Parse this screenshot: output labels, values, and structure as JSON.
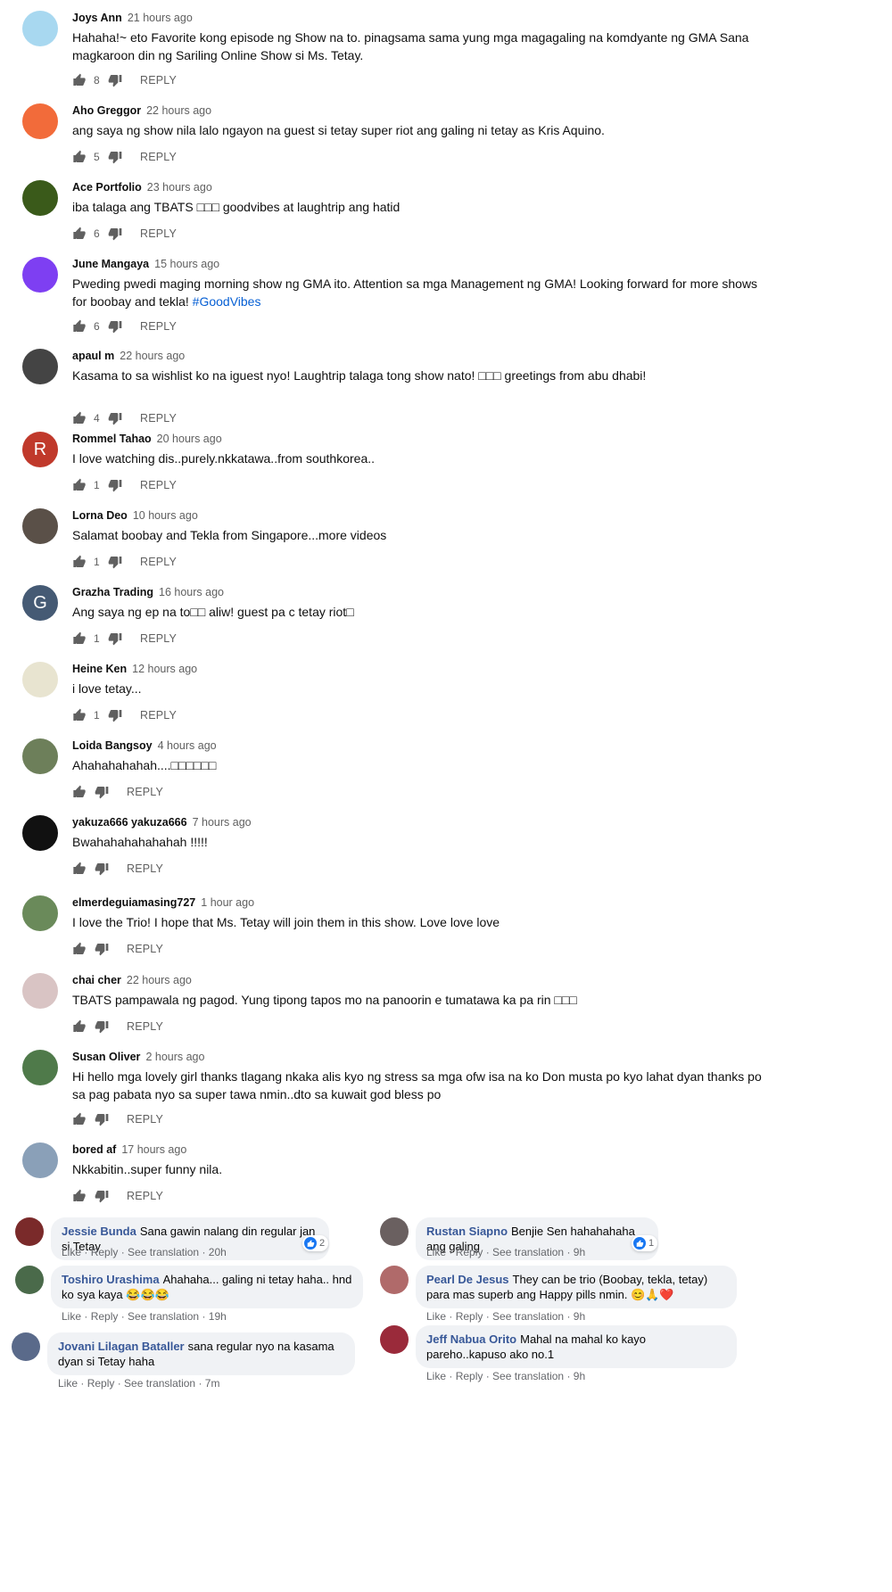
{
  "youtube_comments": [
    {
      "author": "Joys Ann",
      "time": "21 hours ago",
      "text": "Hahaha!~ eto Favorite kong episode ng Show na to. pinagsama sama yung mga magagaling na komdyante ng GMA Sana magkaroon din ng Sariling Online Show si Ms. Tetay.",
      "likes": "8",
      "avatar_color": "#a8d8f0"
    },
    {
      "author": "Aho Greggor",
      "time": "22 hours ago",
      "text": "ang saya ng show nila lalo ngayon na guest si tetay super riot ang galing ni tetay as Kris Aquino.",
      "likes": "5",
      "avatar_color": "#f26b3a"
    },
    {
      "author": "Ace Portfolio",
      "time": "23 hours ago",
      "text": "iba talaga ang TBATS □□□ goodvibes at laughtrip ang hatid",
      "likes": "6",
      "avatar_color": "#3a5a1a"
    },
    {
      "author": "June Mangaya",
      "time": "15 hours ago",
      "text": "Pweding pwedi maging morning show ng GMA ito. Attention sa mga Management ng GMA!  Looking forward for more shows for boobay and tekla! ",
      "hashtag": "#GoodVibes",
      "likes": "6",
      "avatar_color": "#7e3ff2"
    },
    {
      "author": "apaul m",
      "time": "22 hours ago",
      "text": "Kasama to sa wishlist ko na iguest nyo! Laughtrip talaga tong show nato! □□□ greetings from abu dhabi!",
      "likes": "4",
      "avatar_color": "#444444"
    },
    {
      "author": "Rommel Tahao",
      "time": "20 hours ago",
      "text": "I love watching dis..purely.nkkatawa..from southkorea..",
      "likes": "1",
      "avatar_color": "#c0392b",
      "initial": "R"
    },
    {
      "author": "Lorna Deo",
      "time": "10 hours ago",
      "text": "Salamat boobay and Tekla from Singapore...more videos",
      "likes": "1",
      "avatar_color": "#5a5048"
    },
    {
      "author": "Grazha Trading",
      "time": "16 hours ago",
      "text": "Ang saya ng ep na to□□ aliw!  guest pa c tetay riot□",
      "likes": "1",
      "avatar_color": "#455a74",
      "initial": "G"
    },
    {
      "author": "Heine Ken",
      "time": "12 hours ago",
      "text": "i love tetay...",
      "likes": "1",
      "avatar_color": "#e8e4d0"
    },
    {
      "author": "Loida Bangsoy",
      "time": "4 hours ago",
      "text": "Ahahahahahah....□□□□□□",
      "likes": "",
      "avatar_color": "#6d7f5a"
    },
    {
      "author": "yakuza666 yakuza666",
      "time": "7 hours ago",
      "text": "Bwahahahahahahah !!!!!",
      "likes": "",
      "avatar_color": "#111111"
    },
    {
      "author": "elmerdeguiamasing727",
      "time": "1 hour ago",
      "text": "I love the Trio! I hope that Ms. Tetay will join them in this show. Love love love",
      "likes": "",
      "avatar_color": "#6a8a5a"
    },
    {
      "author": "chai cher",
      "time": "22 hours ago",
      "text": "TBATS pampawala ng pagod. Yung tipong tapos mo na panoorin e tumatawa ka pa rin □□□",
      "likes": "",
      "avatar_color": "#d9c4c4"
    },
    {
      "author": "Susan Oliver",
      "time": "2 hours ago",
      "text": "Hi hello mga lovely girl thanks tlagang nkaka alis kyo ng stress sa mga ofw isa na ko Don musta po kyo lahat dyan thanks po sa pag pabata nyo sa super tawa nmin..dto sa kuwait god bless po",
      "likes": "",
      "avatar_color": "#4f7a4a"
    },
    {
      "author": "bored af",
      "time": "17 hours ago",
      "text": "Nkkabitin..super funny nila.",
      "likes": "",
      "avatar_color": "#8aa0b8"
    }
  ],
  "youtube_reply_label": "REPLY",
  "facebook": {
    "links": {
      "like": "Like",
      "reply": "Reply",
      "translate": "See translation",
      "sep": " · "
    },
    "left": [
      {
        "name": "Jessie Bunda",
        "text": "Sana gawin nalang din regular jan si Tetay",
        "time": "20h",
        "reactions": "2",
        "avatar_color": "#7a2a2a"
      },
      {
        "name": "Toshiro Urashima",
        "text": "Ahahaha... galing ni tetay haha.. hnd ko sya kaya ",
        "emoji": "😂😂😂",
        "time": "19h",
        "reactions": "",
        "avatar_color": "#4a6a4a"
      },
      {
        "name": "Jovani Lilagan Bataller",
        "text": "sana regular nyo na kasama dyan si Tetay haha",
        "time": "7m",
        "reactions": "",
        "avatar_color": "#5a6a8a"
      }
    ],
    "right": [
      {
        "name": "Rustan Siapno",
        "text": "Benjie Sen hahahahaha ang galing",
        "time": "9h",
        "reactions": "1",
        "avatar_color": "#6a6060"
      },
      {
        "name": "Pearl De Jesus",
        "text": "They can be trio (Boobay, tekla, tetay) para mas superb ang Happy pills nmin. ",
        "emoji": "😊🙏❤️",
        "time": "9h",
        "reactions": "",
        "avatar_color": "#b06a6a"
      },
      {
        "name": "Jeff Nabua Orito",
        "text": "Mahal na mahal ko kayo pareho..kapuso ako no.1",
        "time": "9h",
        "reactions": "",
        "avatar_color": "#9a2a3a"
      }
    ]
  }
}
